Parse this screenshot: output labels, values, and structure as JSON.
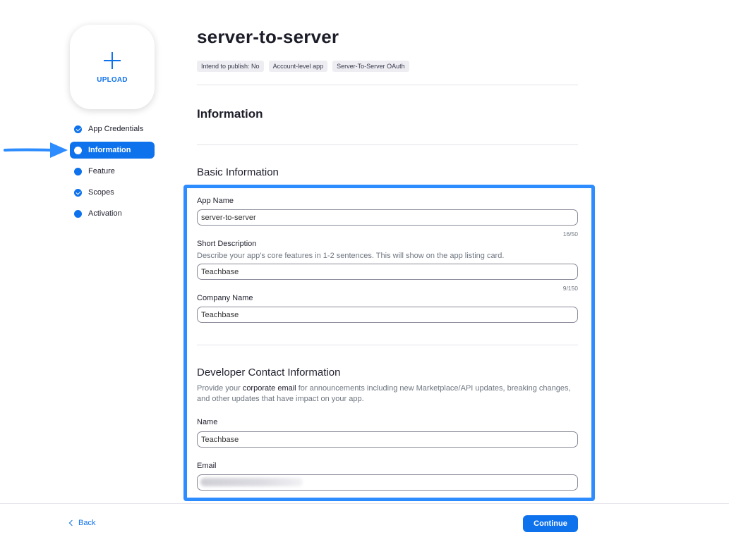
{
  "upload": {
    "label": "UPLOAD"
  },
  "sidebar": {
    "items": [
      {
        "label": "App Credentials",
        "state": "done"
      },
      {
        "label": "Information",
        "state": "active"
      },
      {
        "label": "Feature",
        "state": "pending"
      },
      {
        "label": "Scopes",
        "state": "done"
      },
      {
        "label": "Activation",
        "state": "pending"
      }
    ]
  },
  "header": {
    "title": "server-to-server",
    "tags": [
      "Intend to publish: No",
      "Account-level app",
      "Server-To-Server OAuth"
    ]
  },
  "section": {
    "title": "Information"
  },
  "basic_info": {
    "title": "Basic Information",
    "app_name": {
      "label": "App Name",
      "value": "server-to-server",
      "counter": "16/50"
    },
    "short_description": {
      "label": "Short Description",
      "help": "Describe your app's core features in 1-2 sentences. This will show on the app listing card.",
      "value": "Teachbase",
      "counter": "9/150"
    },
    "company_name": {
      "label": "Company Name",
      "value": "Teachbase"
    }
  },
  "developer_contact": {
    "title": "Developer Contact Information",
    "help_prefix": "Provide your ",
    "help_emphasis": "corporate email",
    "help_suffix": " for announcements including new Marketplace/API updates, breaking changes, and other updates that have impact on your app.",
    "name": {
      "label": "Name",
      "value": "Teachbase"
    },
    "email": {
      "label": "Email",
      "value": ""
    }
  },
  "footer": {
    "back_label": "Back",
    "continue_label": "Continue"
  },
  "colors": {
    "accent": "#0e72ed",
    "annotation": "#2d8cff"
  }
}
